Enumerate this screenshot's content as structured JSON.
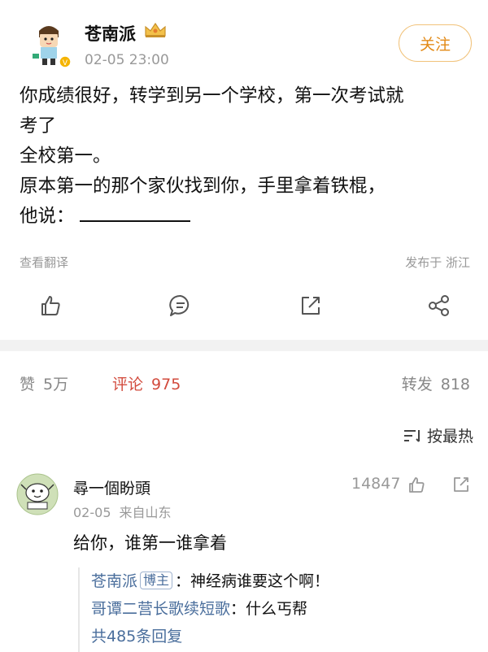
{
  "post": {
    "author": "苍南派",
    "time": "02-05 23:00",
    "follow_label": "关注",
    "lines": [
      "你成绩很好，转学到另一个学校，第一次考试就",
      "考了",
      "全校第一。",
      "原本第一的那个家伙找到你，手里拿着铁棍，",
      "他说："
    ],
    "translate_label": "查看翻译",
    "location": "发布于 浙江",
    "actions": {
      "like_icon": "thumb-up-icon",
      "comment_icon": "comment-icon",
      "share_icon": "share-out-icon",
      "more_icon": "share-nodes-icon"
    }
  },
  "stats": {
    "likes_label": "赞",
    "likes_count": "5万",
    "comments_label": "评论",
    "comments_count": "975",
    "reposts_label": "转发",
    "reposts_count": "818",
    "accent_color": "#d24b3d"
  },
  "sort": {
    "label": "按最热",
    "icon": "sort-icon"
  },
  "comment": {
    "author": "尋一個盼頭",
    "likes": "14847",
    "date": "02-05",
    "source": "来自山东",
    "text": "给你，谁第一谁拿着",
    "replies": [
      {
        "name": "苍南派",
        "tag": "博主",
        "text": "：神经病谁要这个啊！"
      },
      {
        "name": "哥谭二营长歌续短歌",
        "text": "：什么丐帮"
      }
    ],
    "more_replies": "共485条回复"
  }
}
